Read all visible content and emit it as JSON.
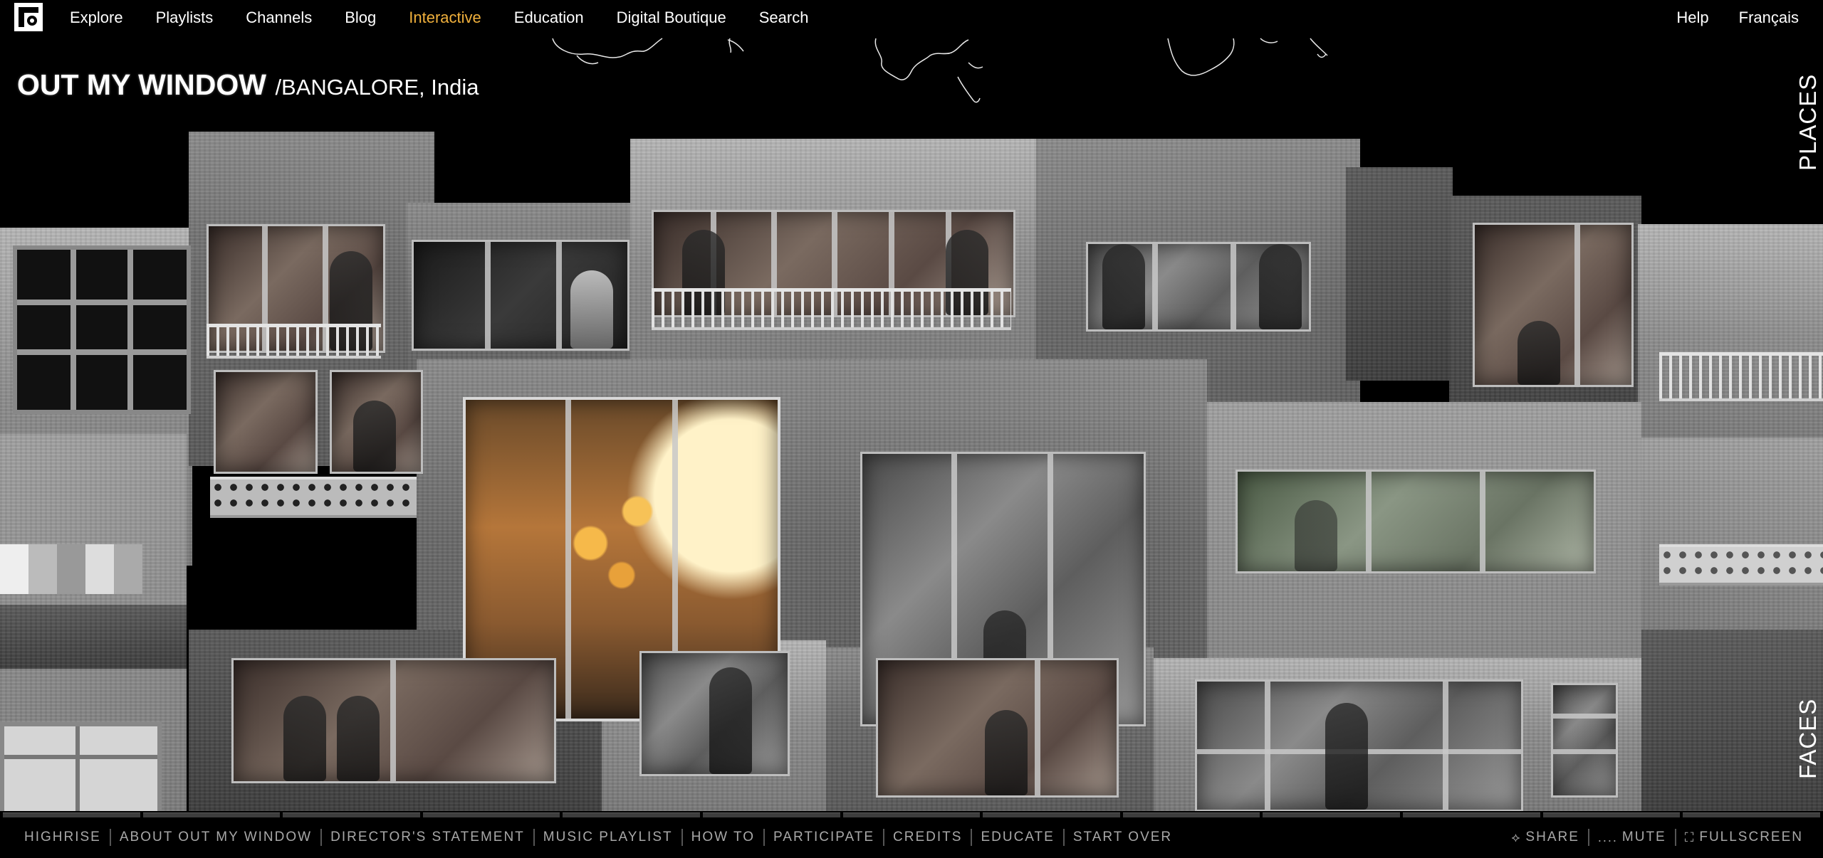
{
  "nav": {
    "logo_icon": "nfb-logo-icon",
    "items": [
      {
        "label": "Explore",
        "active": false
      },
      {
        "label": "Playlists",
        "active": false
      },
      {
        "label": "Channels",
        "active": false
      },
      {
        "label": "Blog",
        "active": false
      },
      {
        "label": "Interactive",
        "active": true
      },
      {
        "label": "Education",
        "active": false
      },
      {
        "label": "Digital Boutique",
        "active": false
      },
      {
        "label": "Search",
        "active": false
      }
    ],
    "right_items": [
      {
        "label": "Help"
      },
      {
        "label": "Français"
      }
    ],
    "active_color": "#f0b03c"
  },
  "title": {
    "main": "OUT MY WINDOW",
    "location": "/BANGALORE, India"
  },
  "side": {
    "places": "PLACES",
    "faces": "FACES"
  },
  "bottom": {
    "items": [
      {
        "label": "HIGHRISE"
      },
      {
        "label": "ABOUT OUT MY WINDOW"
      },
      {
        "label": "DIRECTOR'S STATEMENT"
      },
      {
        "label": "MUSIC PLAYLIST"
      },
      {
        "label": "HOW TO"
      },
      {
        "label": "PARTICIPATE"
      },
      {
        "label": "CREDITS"
      },
      {
        "label": "EDUCATE"
      },
      {
        "label": "START OVER"
      }
    ],
    "right": [
      {
        "label": "SHARE",
        "icon": "share-icon",
        "glyph": "⟡"
      },
      {
        "label": "MUTE",
        "icon": "volume-icon",
        "glyph": "...."
      },
      {
        "label": "FULLSCREEN",
        "icon": "fullscreen-icon",
        "glyph": "⛶"
      }
    ]
  }
}
